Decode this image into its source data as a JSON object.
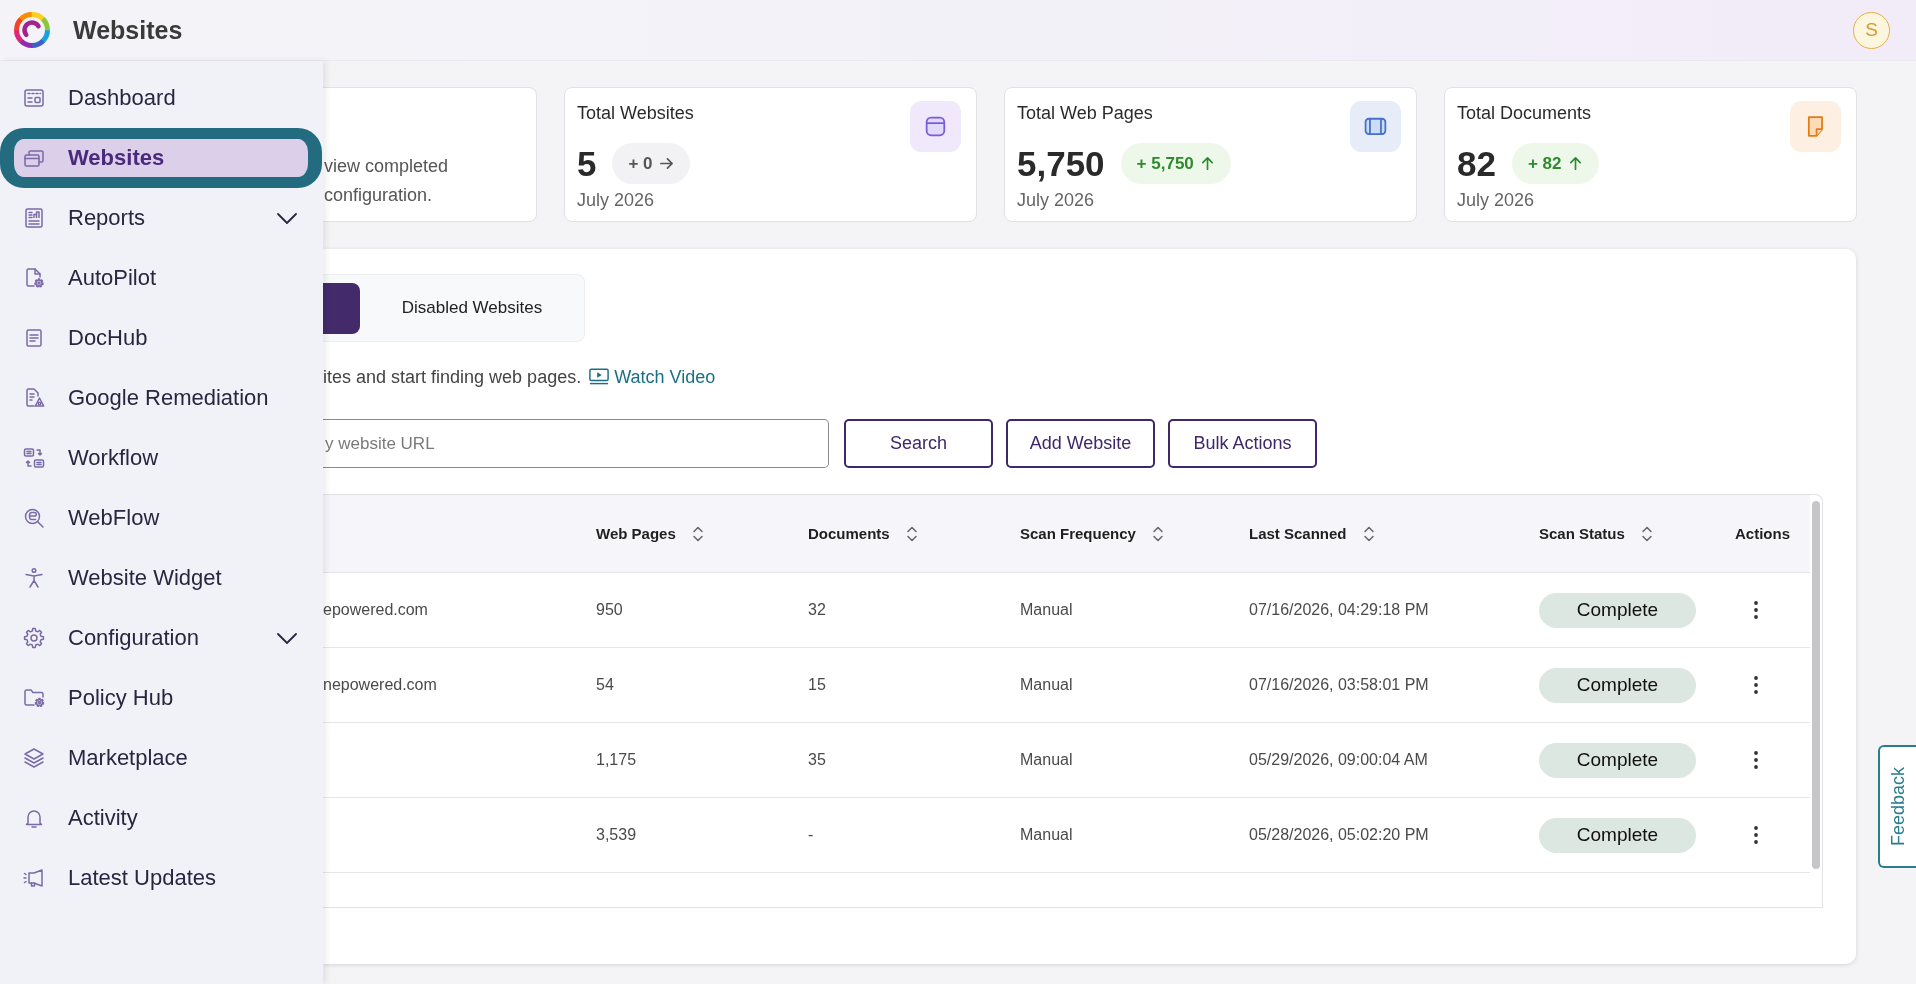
{
  "app": {
    "title": "Websites",
    "user_initial": "S"
  },
  "sidebar": {
    "items": [
      {
        "label": "Dashboard",
        "kind": "link",
        "selected": false
      },
      {
        "label": "Websites",
        "kind": "link",
        "selected": true
      },
      {
        "label": "Reports",
        "kind": "group",
        "selected": false,
        "expanded": false
      },
      {
        "label": "AutoPilot",
        "kind": "link",
        "selected": false
      },
      {
        "label": "DocHub",
        "kind": "link",
        "selected": false
      },
      {
        "label": "Google Remediation",
        "kind": "link",
        "selected": false
      },
      {
        "label": "Workflow",
        "kind": "link",
        "selected": false
      },
      {
        "label": "WebFlow",
        "kind": "link",
        "selected": false
      },
      {
        "label": "Website Widget",
        "kind": "link",
        "selected": false
      },
      {
        "label": "Configuration",
        "kind": "group",
        "selected": false,
        "expanded": false
      },
      {
        "label": "Policy Hub",
        "kind": "link",
        "selected": false
      },
      {
        "label": "Marketplace",
        "kind": "link",
        "selected": false
      },
      {
        "label": "Activity",
        "kind": "link",
        "selected": false
      },
      {
        "label": "Latest Updates",
        "kind": "link",
        "selected": false
      }
    ]
  },
  "intro_card": {
    "text": "view completed\nconfiguration."
  },
  "stats": [
    {
      "kind": "sites",
      "title": "Total Websites",
      "value": "5",
      "change": "+ 0",
      "increase": false,
      "period": "July 2026"
    },
    {
      "kind": "pages",
      "title": "Total Web Pages",
      "value": "5,750",
      "change": "+ 5,750",
      "increase": true,
      "period": "July 2026"
    },
    {
      "kind": "documents",
      "title": "Total Documents",
      "value": "82",
      "change": "+ 82",
      "increase": true,
      "period": "July 2026"
    }
  ],
  "tabs": [
    {
      "selected": true
    },
    {
      "label": "Disabled Websites",
      "selected": false
    }
  ],
  "helper": {
    "text": "ites and start finding web pages.",
    "link": "Watch Video"
  },
  "search": {
    "placeholder": "y website URL"
  },
  "buttons": [
    "Search",
    "Add Website",
    "Bulk Actions"
  ],
  "table": {
    "columns": [
      {
        "label": "Web Pages",
        "sortable": true
      },
      {
        "label": "Documents",
        "sortable": true
      },
      {
        "label": "Scan Frequency",
        "sortable": true
      },
      {
        "label": "Last Scanned",
        "sortable": true
      },
      {
        "label": "Scan Status",
        "sortable": true
      },
      {
        "label": "Actions",
        "sortable": false
      }
    ],
    "rows": [
      {
        "column_1": "epowered.com",
        "web_pages": "950",
        "documents": "32",
        "scan_frequency": "Manual",
        "last_scanned": "07/16/2026, 04:29:18 PM",
        "scan_status": "Complete"
      },
      {
        "column_1": "nepowered.com",
        "web_pages": "54",
        "documents": "15",
        "scan_frequency": "Manual",
        "last_scanned": "07/16/2026, 03:58:01 PM",
        "scan_status": "Complete"
      },
      {
        "web_pages": "1,175",
        "documents": "35",
        "scan_frequency": "Manual",
        "last_scanned": "05/29/2026, 09:00:04 AM",
        "scan_status": "Complete"
      },
      {
        "web_pages": "3,539",
        "documents": "-",
        "scan_frequency": "Manual",
        "last_scanned": "05/28/2026, 05:02:20 PM",
        "scan_status": "Complete"
      }
    ]
  },
  "feedback": "Feedback"
}
